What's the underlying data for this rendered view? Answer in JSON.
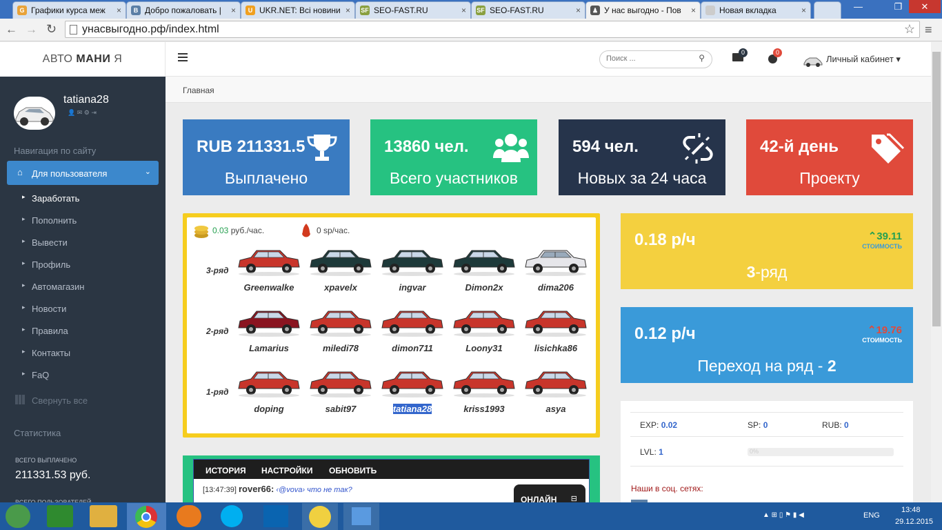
{
  "browser": {
    "tabs": [
      {
        "title": "Графики курса меж",
        "icon": "G",
        "color": "#e8a33a"
      },
      {
        "title": "Добро пожаловать |",
        "icon": "B",
        "color": "#5b7fa6"
      },
      {
        "title": "UKR.NET: Всі новини",
        "icon": "U",
        "color": "#f0a020"
      },
      {
        "title": "SEO-FAST.RU",
        "icon": "SF",
        "color": "#8aa040"
      },
      {
        "title": "SEO-FAST.RU",
        "icon": "SF",
        "color": "#8aa040"
      },
      {
        "title": "У нас выгодно - Пов",
        "icon": "♟",
        "color": "#555555"
      },
      {
        "title": "Новая вкладка",
        "icon": "",
        "color": "#cccccc"
      }
    ],
    "url": "унасвыгодно.рф/index.html"
  },
  "brand": {
    "part1": "АВТО ",
    "part2": "МАНИ",
    "part3": " Я"
  },
  "user": {
    "name": "tatiana28"
  },
  "sidebar": {
    "section_nav": "Навигация по сайту",
    "group": "Для пользователя",
    "items": [
      "Заработать",
      "Пополнить",
      "Вывести",
      "Профиль",
      "Автомагазин",
      "Новости",
      "Правила",
      "Контакты",
      "FaQ"
    ],
    "collapse": "Свернуть все",
    "section_stats": "Статистика",
    "total_paid_label": "ВСЕГО ВЫПЛАЧЕНО",
    "total_paid_value": "211331.53 руб.",
    "total_users_label": "ВСЕГО ПОЛЬЗОВАТЕЛЕЙ"
  },
  "topnav": {
    "search_placeholder": "Поиск ...",
    "mail_count": "0",
    "notif_count": "0",
    "cabinet": "Личный кабинет"
  },
  "breadcrumb": "Главная",
  "stats": [
    {
      "value": "RUB 211331.5",
      "label": "Выплачено",
      "color": "#3a7bc1",
      "icon": "trophy-icon"
    },
    {
      "value": "13860 чел.",
      "label": "Всего участников",
      "color": "#26c281",
      "icon": "users-icon"
    },
    {
      "value": "594 чел.",
      "label": "Новых за 24 часа",
      "color": "#26344b",
      "icon": "link-icon"
    },
    {
      "value": "42-й день",
      "label": "Проекту",
      "color": "#e04a3b",
      "icon": "tags-icon"
    }
  ],
  "game": {
    "rate_rub_value": "0.03",
    "rate_rub_unit": " руб./час.",
    "rate_sp": "0 sp/час.",
    "rows": [
      {
        "label": "3-ряд",
        "cars": [
          {
            "name": "Greenwalke",
            "color": "#c8352b"
          },
          {
            "name": "xpavelx",
            "color": "#1e3a3a"
          },
          {
            "name": "ingvar",
            "color": "#1e3a3a"
          },
          {
            "name": "Dimon2x",
            "color": "#1e3a3a"
          },
          {
            "name": "dima206",
            "color": "#e6e6ea"
          }
        ]
      },
      {
        "label": "2-ряд",
        "cars": [
          {
            "name": "Lamarius",
            "color": "#8a1420"
          },
          {
            "name": "miledi78",
            "color": "#c8352b"
          },
          {
            "name": "dimon711",
            "color": "#c8352b"
          },
          {
            "name": "Loony31",
            "color": "#c8352b"
          },
          {
            "name": "lisichka86",
            "color": "#c8352b"
          }
        ]
      },
      {
        "label": "1-ряд",
        "cars": [
          {
            "name": "doping",
            "color": "#c8352b"
          },
          {
            "name": "sabit97",
            "color": "#c8352b"
          },
          {
            "name": "tatiana28",
            "color": "#c8352b"
          },
          {
            "name": "kriss1993",
            "color": "#c8352b"
          },
          {
            "name": "asya",
            "color": "#c8352b"
          }
        ]
      }
    ]
  },
  "chat": {
    "tabs": [
      "ИСТОРИЯ",
      "НАСТРОЙКИ",
      "ОБНОВИТЬ"
    ],
    "time": "[13:47:39]",
    "author": "rover66:",
    "to": "‹@vova›",
    "msg": "что не так?",
    "online": "ОНЛАЙН"
  },
  "row3card": {
    "value": "0.18 р/ч",
    "delta": "39.11",
    "cost_label": "СТОИМОСТЬ",
    "row_num": "3",
    "row_suffix": "-ряд"
  },
  "nextcard": {
    "value": "0.12 р/ч",
    "delta": "19.76",
    "cost_label": "СТОИМОСТЬ",
    "label": "Переход на ряд - ",
    "row_num": "2"
  },
  "profile": {
    "exp_label": "EXP:",
    "exp_value": "0.02",
    "sp_label": "SP:",
    "sp_value": "0",
    "rub_label": "RUB:",
    "rub_value": "0",
    "lvl_label": "LVL:",
    "lvl_value": "1",
    "progress_text": "0%",
    "progress": 0,
    "social": "Наши в соц. сетях:"
  },
  "taskbar": {
    "lang": "ENG",
    "time": "13:48",
    "date": "29.12.2015"
  }
}
